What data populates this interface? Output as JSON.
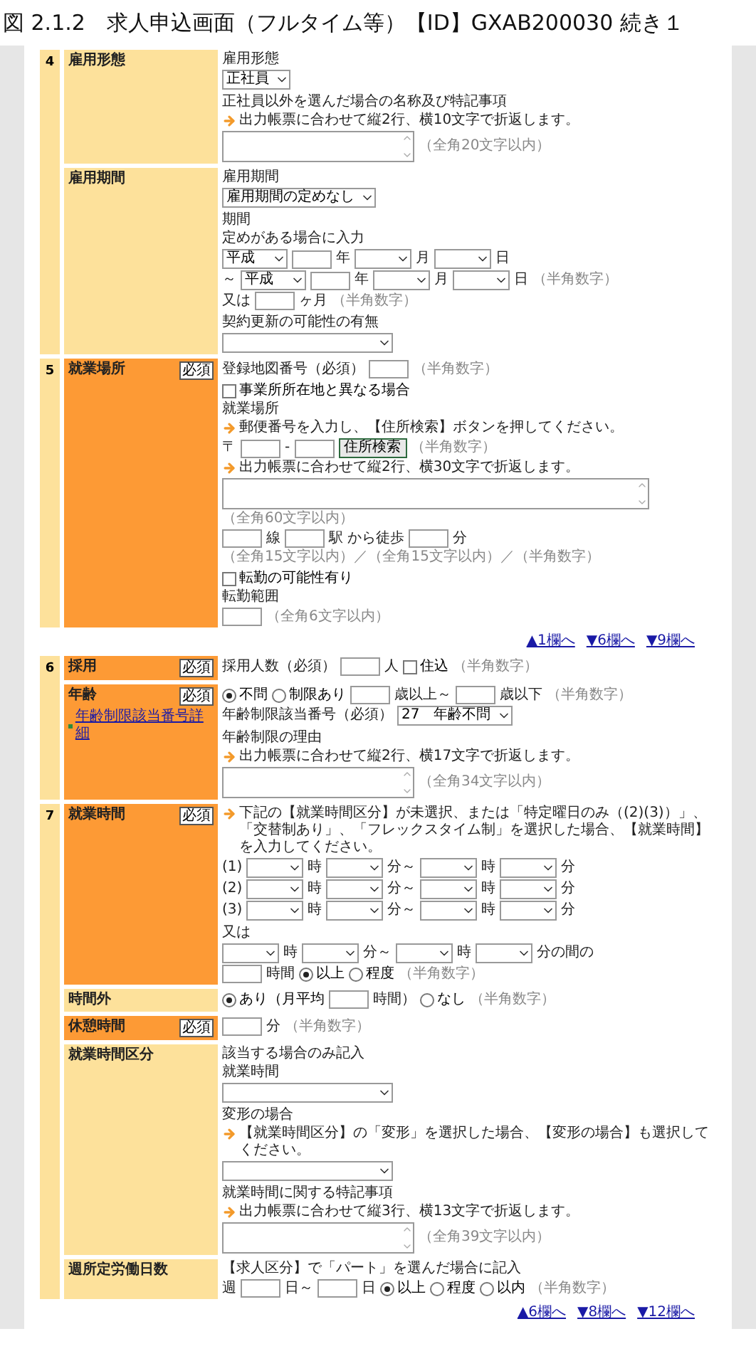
{
  "title": "図 2.1.2　求人申込画面（フルタイム等）【ID】GXAB200030 続き１",
  "sections": [
    {
      "number": "4",
      "rows": [
        {
          "label": "雇用形態",
          "required": false,
          "groups": [
            [
              [
                {
                  "kind": "text",
                  "text": "雇用形態"
                }
              ],
              [
                {
                  "kind": "select",
                  "value": "正社員"
                }
              ]
            ],
            [
              [
                {
                  "kind": "text",
                  "text": "正社員以外を選んだ場合の名称及び特記事項"
                }
              ],
              [
                {
                  "kind": "note",
                  "text": "出力帳票に合わせて縦2行、横10文字で折返します。"
                }
              ],
              [
                {
                  "kind": "textarea"
                },
                {
                  "kind": "hint",
                  "text": "（全角20文字以内）"
                }
              ]
            ]
          ]
        },
        {
          "label": "雇用期間",
          "required": false,
          "groups": [
            [
              [
                {
                  "kind": "text",
                  "text": "雇用期間"
                }
              ],
              [
                {
                  "kind": "select",
                  "value": "雇用期間の定めなし"
                }
              ]
            ],
            [
              [
                {
                  "kind": "text",
                  "text": "期間"
                }
              ],
              [
                {
                  "kind": "text",
                  "text": "定めがある場合に入力"
                }
              ],
              [
                {
                  "kind": "select",
                  "value": "平成"
                },
                {
                  "kind": "input"
                },
                {
                  "kind": "text",
                  "text": "年"
                },
                {
                  "kind": "select"
                },
                {
                  "kind": "text",
                  "text": "月"
                },
                {
                  "kind": "select"
                },
                {
                  "kind": "text",
                  "text": "日"
                }
              ],
              [
                {
                  "kind": "text",
                  "text": "～"
                },
                {
                  "kind": "select",
                  "value": "平成"
                },
                {
                  "kind": "input"
                },
                {
                  "kind": "text",
                  "text": "年"
                },
                {
                  "kind": "select"
                },
                {
                  "kind": "text",
                  "text": "月"
                },
                {
                  "kind": "select"
                },
                {
                  "kind": "text",
                  "text": "日"
                },
                {
                  "kind": "hint",
                  "text": "（半角数字）"
                }
              ],
              [
                {
                  "kind": "text",
                  "text": "又は"
                },
                {
                  "kind": "input"
                },
                {
                  "kind": "text",
                  "text": "ヶ月"
                },
                {
                  "kind": "hint",
                  "text": "（半角数字）"
                }
              ]
            ],
            [
              [
                {
                  "kind": "text",
                  "text": "契約更新の可能性の有無"
                }
              ],
              [
                {
                  "kind": "select"
                }
              ]
            ]
          ]
        }
      ]
    },
    {
      "number": "5",
      "rows": [
        {
          "label": "就業場所",
          "required": true,
          "badge": "必須",
          "groups": [
            [
              [
                {
                  "kind": "text",
                  "text": "登録地図番号（必須）"
                },
                {
                  "kind": "input"
                },
                {
                  "kind": "hint",
                  "text": "（半角数字）"
                }
              ]
            ],
            [
              [
                {
                  "kind": "checkbox",
                  "label": "事業所所在地と異なる場合",
                  "checked": false
                }
              ],
              [
                {
                  "kind": "text",
                  "text": "就業場所"
                }
              ],
              [
                {
                  "kind": "note",
                  "text": "郵便番号を入力し、【住所検索】ボタンを押してください。"
                }
              ],
              [
                {
                  "kind": "text",
                  "text": "〒"
                },
                {
                  "kind": "input"
                },
                {
                  "kind": "text",
                  "text": "-"
                },
                {
                  "kind": "input"
                },
                {
                  "kind": "button",
                  "label": "住所検索"
                },
                {
                  "kind": "hint",
                  "text": "（半角数字）"
                }
              ],
              [
                {
                  "kind": "note",
                  "text": "出力帳票に合わせて縦2行、横30文字で折返します。"
                }
              ],
              [
                {
                  "kind": "textarea"
                }
              ],
              [
                {
                  "kind": "hint",
                  "text": "（全角60文字以内）"
                }
              ],
              [
                {
                  "kind": "input"
                },
                {
                  "kind": "text",
                  "text": "線"
                },
                {
                  "kind": "input"
                },
                {
                  "kind": "text",
                  "text": "駅 から徒歩"
                },
                {
                  "kind": "input"
                },
                {
                  "kind": "text",
                  "text": "分"
                }
              ],
              [
                {
                  "kind": "hint",
                  "text": "（全角15文字以内）／（全角15文字以内）／（半角数字）"
                }
              ]
            ],
            [
              [
                {
                  "kind": "checkbox",
                  "label": "転勤の可能性有り",
                  "checked": false
                }
              ],
              [
                {
                  "kind": "text",
                  "text": "転勤範囲"
                }
              ],
              [
                {
                  "kind": "input"
                },
                {
                  "kind": "hint",
                  "text": "（全角6文字以内）"
                }
              ]
            ]
          ]
        }
      ],
      "nav": [
        "▲1欄へ",
        "▼6欄へ",
        "▼9欄へ"
      ]
    },
    {
      "number": "6",
      "rows": [
        {
          "label": "採用",
          "required": true,
          "badge": "必須",
          "groups": [
            [
              [
                {
                  "kind": "text",
                  "text": "採用人数（必須）"
                },
                {
                  "kind": "input"
                },
                {
                  "kind": "text",
                  "text": "人"
                },
                {
                  "kind": "checkbox",
                  "label": "住込",
                  "checked": false
                },
                {
                  "kind": "hint",
                  "text": "（半角数字）"
                }
              ]
            ]
          ]
        },
        {
          "label": "年齢",
          "required": true,
          "badge": "必須",
          "link": "年齢制限該当番号詳細",
          "groups": [
            [
              [
                {
                  "kind": "radio",
                  "label": "不問",
                  "selected": true
                },
                {
                  "kind": "radio",
                  "label": "制限あり",
                  "selected": false
                },
                {
                  "kind": "input"
                },
                {
                  "kind": "text",
                  "text": "歳以上～"
                },
                {
                  "kind": "input"
                },
                {
                  "kind": "text",
                  "text": "歳以下"
                },
                {
                  "kind": "hint",
                  "text": "（半角数字）"
                }
              ],
              [
                {
                  "kind": "text",
                  "text": "年齢制限該当番号（必須）"
                },
                {
                  "kind": "select",
                  "value": "27　年齢不問"
                }
              ]
            ],
            [
              [
                {
                  "kind": "text",
                  "text": "年齢制限の理由"
                }
              ],
              [
                {
                  "kind": "note",
                  "text": "出力帳票に合わせて縦2行、横17文字で折返します。"
                }
              ],
              [
                {
                  "kind": "textarea"
                },
                {
                  "kind": "hint",
                  "text": "（全角34文字以内）"
                }
              ]
            ]
          ]
        }
      ]
    },
    {
      "number": "7",
      "rows": [
        {
          "label": "就業時間",
          "required": true,
          "badge": "必須",
          "groups": [
            [
              [
                {
                  "kind": "note",
                  "text": "下記の【就業時間区分】が未選択、または「特定曜日のみ（(2)(3)）」、「交替制あり」、「フレックスタイム制」を選択した場合、【就業時間】を入力してください。"
                }
              ],
              [
                {
                  "kind": "text",
                  "text": "(1)"
                },
                {
                  "kind": "select"
                },
                {
                  "kind": "text",
                  "text": "時"
                },
                {
                  "kind": "select"
                },
                {
                  "kind": "text",
                  "text": "分～"
                },
                {
                  "kind": "select"
                },
                {
                  "kind": "text",
                  "text": "時"
                },
                {
                  "kind": "select"
                },
                {
                  "kind": "text",
                  "text": "分"
                }
              ],
              [
                {
                  "kind": "text",
                  "text": "(2)"
                },
                {
                  "kind": "select"
                },
                {
                  "kind": "text",
                  "text": "時"
                },
                {
                  "kind": "select"
                },
                {
                  "kind": "text",
                  "text": "分～"
                },
                {
                  "kind": "select"
                },
                {
                  "kind": "text",
                  "text": "時"
                },
                {
                  "kind": "select"
                },
                {
                  "kind": "text",
                  "text": "分"
                }
              ],
              [
                {
                  "kind": "text",
                  "text": "(3)"
                },
                {
                  "kind": "select"
                },
                {
                  "kind": "text",
                  "text": "時"
                },
                {
                  "kind": "select"
                },
                {
                  "kind": "text",
                  "text": "分～"
                },
                {
                  "kind": "select"
                },
                {
                  "kind": "text",
                  "text": "時"
                },
                {
                  "kind": "select"
                },
                {
                  "kind": "text",
                  "text": "分"
                }
              ]
            ],
            [
              [
                {
                  "kind": "text",
                  "text": "又は"
                }
              ],
              [
                {
                  "kind": "select"
                },
                {
                  "kind": "text",
                  "text": "時"
                },
                {
                  "kind": "select"
                },
                {
                  "kind": "text",
                  "text": "分～"
                },
                {
                  "kind": "select"
                },
                {
                  "kind": "text",
                  "text": "時"
                },
                {
                  "kind": "select"
                },
                {
                  "kind": "text",
                  "text": "分の間の"
                }
              ],
              [
                {
                  "kind": "input"
                },
                {
                  "kind": "text",
                  "text": "時間"
                },
                {
                  "kind": "radio",
                  "label": "以上",
                  "selected": true
                },
                {
                  "kind": "radio",
                  "label": "程度",
                  "selected": false
                },
                {
                  "kind": "hint",
                  "text": "（半角数字）"
                }
              ]
            ]
          ]
        },
        {
          "label": "時間外",
          "required": false,
          "groups": [
            [
              [
                {
                  "kind": "radio",
                  "label": "あり（月平均",
                  "selected": true
                },
                {
                  "kind": "input"
                },
                {
                  "kind": "text",
                  "text": "時間）"
                },
                {
                  "kind": "radio",
                  "label": "なし",
                  "selected": false
                },
                {
                  "kind": "hint",
                  "text": "（半角数字）"
                }
              ]
            ]
          ]
        },
        {
          "label": "休憩時間",
          "required": true,
          "badge": "必須",
          "groups": [
            [
              [
                {
                  "kind": "input"
                },
                {
                  "kind": "text",
                  "text": "分"
                },
                {
                  "kind": "hint",
                  "text": "（半角数字）"
                }
              ]
            ]
          ]
        },
        {
          "label": "就業時間区分",
          "required": false,
          "groups": [
            [
              [
                {
                  "kind": "text",
                  "text": "該当する場合のみ記入"
                }
              ],
              [
                {
                  "kind": "text",
                  "text": "就業時間"
                }
              ],
              [
                {
                  "kind": "select"
                }
              ]
            ],
            [
              [
                {
                  "kind": "text",
                  "text": "変形の場合"
                }
              ],
              [
                {
                  "kind": "note",
                  "text": "【就業時間区分】の「変形」を選択した場合、【変形の場合】も選択してください。"
                }
              ],
              [
                {
                  "kind": "select"
                }
              ]
            ],
            [
              [
                {
                  "kind": "text",
                  "text": "就業時間に関する特記事項"
                }
              ],
              [
                {
                  "kind": "note",
                  "text": "出力帳票に合わせて縦3行、横13文字で折返します。"
                }
              ],
              [
                {
                  "kind": "textarea"
                },
                {
                  "kind": "hint",
                  "text": "（全角39文字以内）"
                }
              ]
            ]
          ]
        },
        {
          "label": "週所定労働日数",
          "required": false,
          "groups": [
            [
              [
                {
                  "kind": "text",
                  "text": "【求人区分】で「パート」を選んだ場合に記入"
                }
              ],
              [
                {
                  "kind": "text",
                  "text": "週"
                },
                {
                  "kind": "input"
                },
                {
                  "kind": "text",
                  "text": "日～"
                },
                {
                  "kind": "input"
                },
                {
                  "kind": "text",
                  "text": "日"
                },
                {
                  "kind": "radio",
                  "label": "以上",
                  "selected": true
                },
                {
                  "kind": "radio",
                  "label": "程度",
                  "selected": false
                },
                {
                  "kind": "radio",
                  "label": "以内",
                  "selected": false
                },
                {
                  "kind": "hint",
                  "text": "（半角数字）"
                }
              ]
            ]
          ]
        }
      ],
      "nav": [
        "▲6欄へ",
        "▼8欄へ",
        "▼12欄へ"
      ]
    }
  ]
}
